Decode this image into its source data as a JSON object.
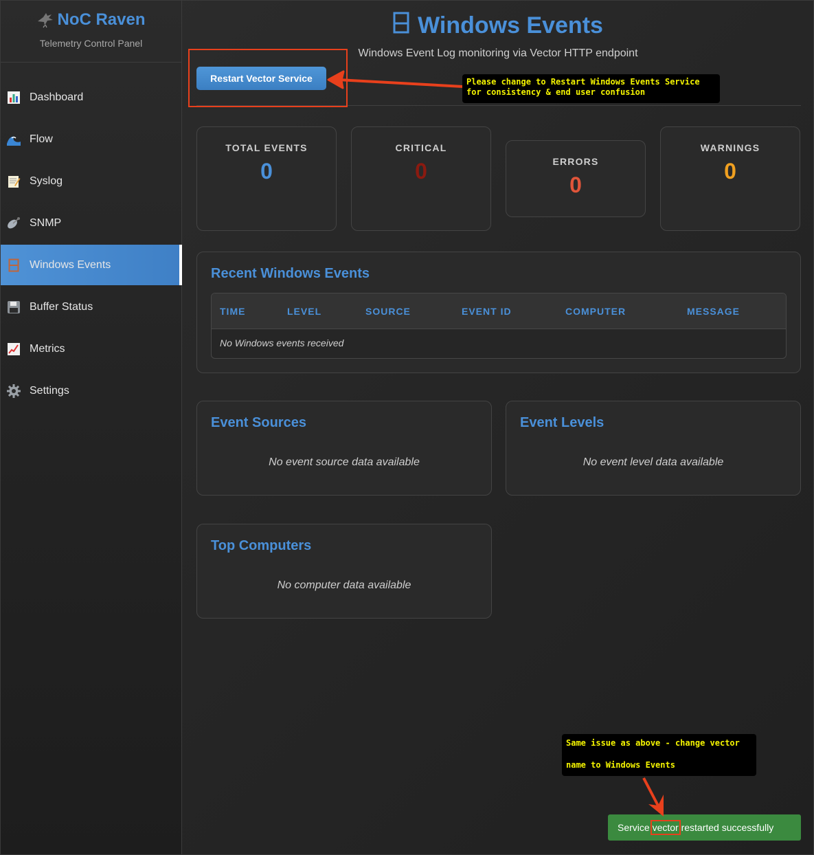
{
  "sidebar": {
    "brand_title": "NoC Raven",
    "brand_subtitle": "Telemetry Control Panel",
    "items": [
      {
        "label": "Dashboard",
        "icon": "bar-chart-icon",
        "active": false
      },
      {
        "label": "Flow",
        "icon": "wave-icon",
        "active": false
      },
      {
        "label": "Syslog",
        "icon": "memo-icon",
        "active": false
      },
      {
        "label": "SNMP",
        "icon": "satellite-icon",
        "active": false
      },
      {
        "label": "Windows Events",
        "icon": "window-icon",
        "active": true
      },
      {
        "label": "Buffer Status",
        "icon": "floppy-disk-icon",
        "active": false
      },
      {
        "label": "Metrics",
        "icon": "line-chart-icon",
        "active": false
      },
      {
        "label": "Settings",
        "icon": "gear-icon",
        "active": false
      }
    ]
  },
  "header": {
    "title": "Windows Events",
    "subtitle": "Windows Event Log monitoring via Vector HTTP endpoint",
    "restart_label": "Restart Vector Service"
  },
  "stats": [
    {
      "label": "TOTAL EVENTS",
      "value": "0",
      "color": "#4a90d9"
    },
    {
      "label": "CRITICAL",
      "value": "0",
      "color": "#8b1a10"
    },
    {
      "label": "ERRORS",
      "value": "0",
      "color": "#e0553a"
    },
    {
      "label": "WARNINGS",
      "value": "0",
      "color": "#f0a020"
    }
  ],
  "recent_events": {
    "title": "Recent Windows Events",
    "columns": [
      "TIME",
      "LEVEL",
      "SOURCE",
      "EVENT ID",
      "COMPUTER",
      "MESSAGE"
    ],
    "empty": "No Windows events received"
  },
  "event_sources": {
    "title": "Event Sources",
    "empty": "No event source data available"
  },
  "event_levels": {
    "title": "Event Levels",
    "empty": "No event level data available"
  },
  "top_computers": {
    "title": "Top Computers",
    "empty": "No computer data available"
  },
  "toast": {
    "prefix": "Service ",
    "highlight": "vector",
    "suffix": " restarted successfully"
  },
  "annotations": {
    "note1_line1": "Please change to Restart Windows Events Service",
    "note1_line2": "for consistency & end user confusion",
    "note2_line1": "Same issue as above - change vector",
    "note2_line2": "name to Windows Events"
  },
  "colors": {
    "accent": "#4a90d9",
    "annotation": "#e8401c",
    "toast": "#3b8a3f"
  }
}
